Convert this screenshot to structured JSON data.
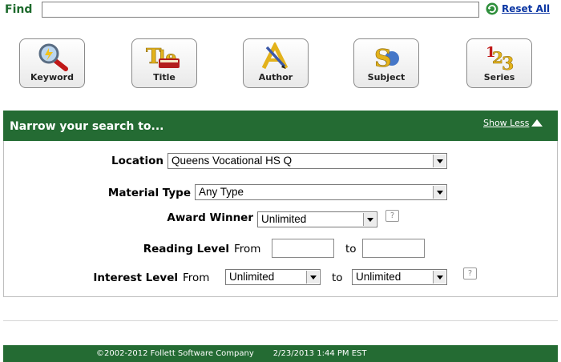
{
  "find": {
    "label": "Find",
    "value": "",
    "reset_label": "Reset All"
  },
  "search_buttons": [
    {
      "label": "Keyword",
      "icon": "magnifier-icon"
    },
    {
      "label": "Title",
      "icon": "title-book-icon"
    },
    {
      "label": "Author",
      "icon": "author-pen-icon"
    },
    {
      "label": "Subject",
      "icon": "subject-letters-icon"
    },
    {
      "label": "Series",
      "icon": "series-numbers-icon"
    }
  ],
  "narrow": {
    "title": "Narrow your search to...",
    "show_less": "Show Less",
    "location": {
      "label": "Location",
      "value": "Queens Vocational HS Q"
    },
    "material_type": {
      "label": "Material Type",
      "value": "Any Type"
    },
    "award_winner": {
      "label": "Award Winner",
      "value": "Unlimited",
      "help": "?"
    },
    "reading_level": {
      "label": "Reading Level",
      "from": "From",
      "to": "to",
      "from_value": "",
      "to_value": ""
    },
    "interest_level": {
      "label": "Interest Level",
      "from": "From",
      "from_value": "Unlimited",
      "to": "to",
      "to_value": "Unlimited",
      "help": "?"
    }
  },
  "footer": {
    "copyright": "©2002-2012  Follett Software Company",
    "datetime": "2/23/2013 1:44 PM EST"
  },
  "colors": {
    "green": "#246b33",
    "link": "#0b36a3"
  }
}
